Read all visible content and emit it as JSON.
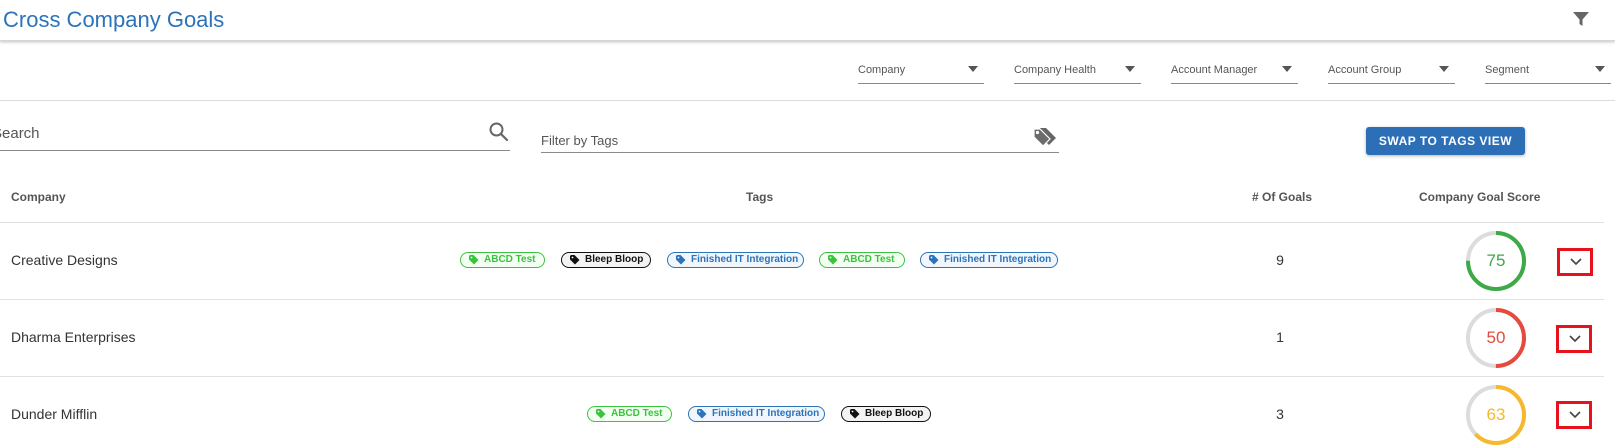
{
  "header": {
    "title": "Cross Company Goals",
    "filter_icon": "filter-icon"
  },
  "filters": [
    {
      "label": "Company"
    },
    {
      "label": "Company Health"
    },
    {
      "label": "Account Manager"
    },
    {
      "label": "Account Group"
    },
    {
      "label": "Segment"
    }
  ],
  "search": {
    "placeholder": "Search",
    "icon": "search-icon"
  },
  "tag_filter": {
    "placeholder": "Filter by Tags",
    "icon": "tags-icon"
  },
  "swap_button": {
    "label": "SWAP TO TAGS VIEW"
  },
  "table": {
    "headers": {
      "company": "Company",
      "tags": "Tags",
      "goals": "# Of Goals",
      "score": "Company Goal Score"
    },
    "rows": [
      {
        "company": "Creative Designs",
        "tags": [
          {
            "label": "ABCD Test",
            "color": "green"
          },
          {
            "label": "Bleep Bloop",
            "color": "black"
          },
          {
            "label": "Finished IT Integration",
            "color": "blue"
          },
          {
            "label": "ABCD Test",
            "color": "green"
          },
          {
            "label": "Finished IT Integration",
            "color": "blue"
          }
        ],
        "goals": "9",
        "score": "75",
        "score_color": "#3daa47"
      },
      {
        "company": "Dharma Enterprises",
        "tags": [],
        "goals": "1",
        "score": "50",
        "score_color": "#e64a3f"
      },
      {
        "company": "Dunder Mifflin",
        "tags": [
          {
            "label": "ABCD Test",
            "color": "green"
          },
          {
            "label": "Finished IT Integration",
            "color": "blue"
          },
          {
            "label": "Bleep Bloop",
            "color": "black"
          }
        ],
        "goals": "3",
        "score": "63",
        "score_color": "#f5b82e"
      }
    ]
  },
  "colors": {
    "accent": "#2c73b9",
    "tag_green": "#39c43c",
    "tag_black": "#111111",
    "tag_blue": "#2c73b9",
    "highlight_box": "#e8121f",
    "ring_track": "#dcdcdc"
  }
}
